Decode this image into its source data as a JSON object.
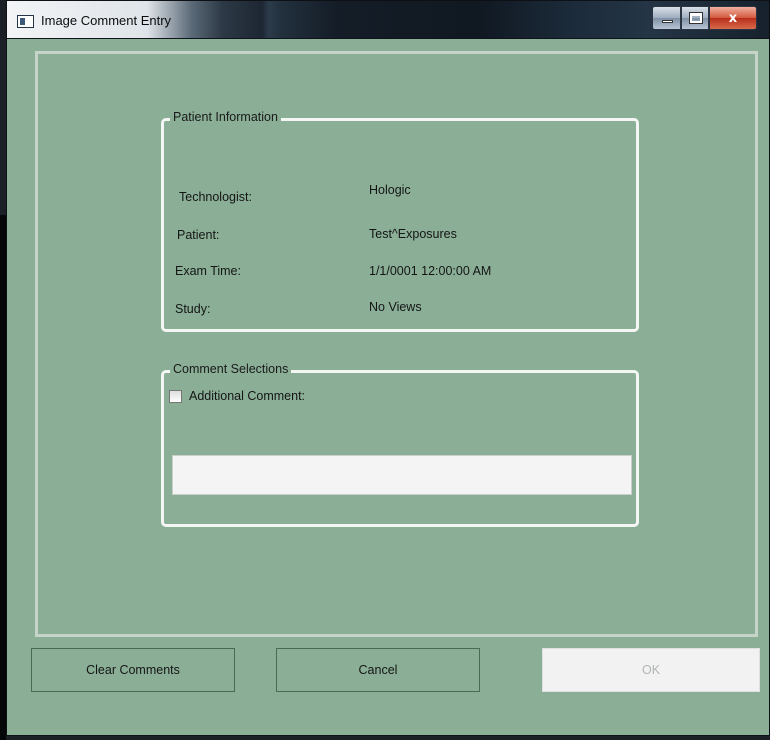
{
  "window": {
    "title": "Image Comment Entry",
    "controls": {
      "close_glyph": "x"
    }
  },
  "patient_info": {
    "legend": "Patient Information",
    "fields": [
      {
        "label": "Technologist:",
        "value": "Hologic"
      },
      {
        "label": "Patient:",
        "value": "Test^Exposures"
      },
      {
        "label": "Exam Time:",
        "value": "1/1/0001 12:00:00 AM"
      },
      {
        "label": "Study:",
        "value": "No Views"
      }
    ]
  },
  "comments": {
    "legend": "Comment Selections",
    "additional_comment_label": "Additional Comment:",
    "additional_comment_checked": false,
    "comment_text": ""
  },
  "buttons": {
    "clear": "Clear Comments",
    "cancel": "Cancel",
    "ok": "OK",
    "ok_enabled": false
  },
  "colors": {
    "background": "#8aaf96",
    "groupbox_border": "#f4f6f4",
    "ok_disabled_bg": "#f2f2f2"
  },
  "icons": [
    "app-icon",
    "minimize-icon",
    "maximize-icon",
    "close-icon"
  ]
}
